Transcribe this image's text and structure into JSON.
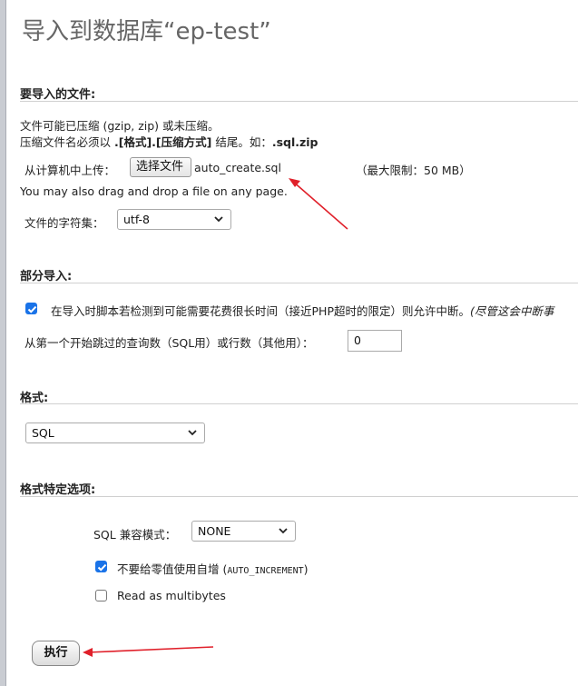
{
  "page_title": "导入到数据库“ep-test”",
  "file_section": {
    "legend": "要导入的文件:",
    "line1": "文件可能已压缩 (gzip, zip) 或未压缩。",
    "line2_prefix": "压缩文件名必须以 ",
    "line2_bold1": ".[格式].[压缩方式]",
    "line2_mid": " 结尾。如：",
    "line2_bold2": ".sql.zip",
    "upload_label": "从计算机中上传：",
    "choose_file_button": "选择文件",
    "chosen_file": "auto_create.sql",
    "max_limit": "（最大限制：50 MB）",
    "drag_hint": "You may also drag and drop a file on any page.",
    "charset_label": "文件的字符集：",
    "charset_value": "utf-8"
  },
  "partial_section": {
    "legend": "部分导入:",
    "allow_interrupt_label": "在导入时脚本若检测到可能需要花费很长时间（接近PHP超时的限定）则允许中断。",
    "allow_interrupt_note": "(尽管这会中断事",
    "allow_interrupt_checked": true,
    "skip_label": "从第一个开始跳过的查询数（SQL用）或行数（其他用）：",
    "skip_value": "0"
  },
  "format_section": {
    "legend": "格式:",
    "format_value": "SQL"
  },
  "format_options_section": {
    "legend": "格式特定选项:",
    "compat_label": "SQL 兼容模式：",
    "compat_value": "NONE",
    "no_auto_value_label": "不要给零值使用自增 (",
    "no_auto_value_code": "AUTO_INCREMENT",
    "no_auto_value_close": ")",
    "no_auto_value_checked": true,
    "multibytes_label": "Read as multibytes",
    "multibytes_checked": false
  },
  "execute_button": "执行",
  "colors": {
    "accent": "#1a73e8",
    "annotation_arrow": "#e0202a"
  }
}
